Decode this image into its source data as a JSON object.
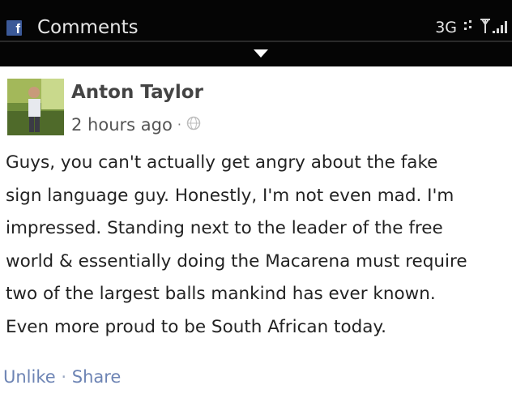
{
  "header": {
    "app_icon": "facebook-icon",
    "title": "Comments",
    "network": "3G",
    "status_icons": [
      "data-transfer-icon",
      "signal-strength-icon"
    ]
  },
  "post": {
    "author": "Anton Taylor",
    "time": "2 hours ago",
    "separator": "·",
    "privacy_icon": "globe-icon",
    "text": "Guys, you can't actually get angry about the fake\nsign language guy. Honestly, I'm not even mad. I'm\nimpressed. Standing next to the leader of the free\nworld & essentially doing the Macarena must require\ntwo of the largest balls mankind has ever known.\nEven more proud to be South African today.",
    "actions": {
      "unlike": "Unlike",
      "separator": "·",
      "share": "Share"
    }
  },
  "colors": {
    "topbar": "#050505",
    "facebook_blue": "#3b5998",
    "link": "#6d84b4"
  }
}
